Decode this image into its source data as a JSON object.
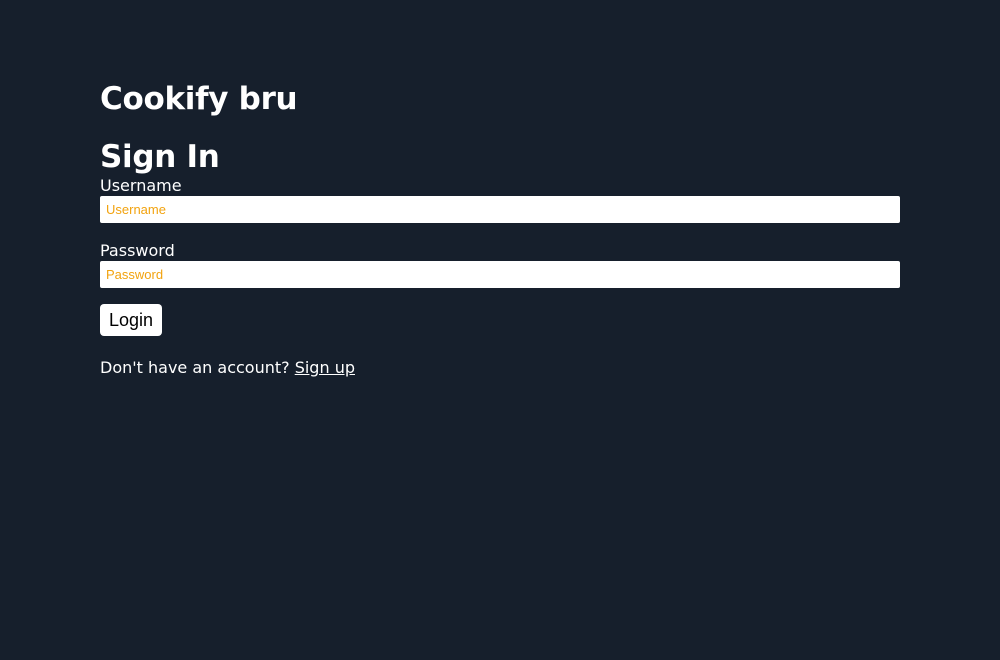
{
  "app": {
    "title": "Cookify bru"
  },
  "form": {
    "title": "Sign In",
    "username": {
      "label": "Username",
      "value": "",
      "placeholder": "Username"
    },
    "password": {
      "label": "Password",
      "value": "",
      "placeholder": "Password"
    },
    "login_label": "Login"
  },
  "signup": {
    "prompt": "Don't have an account?",
    "link_label": "Sign up"
  },
  "colors": {
    "background": "#161f2c",
    "text": "#ffffff",
    "placeholder": "#f2a30f",
    "input_background": "#ffffff",
    "button_text": "#000000"
  }
}
